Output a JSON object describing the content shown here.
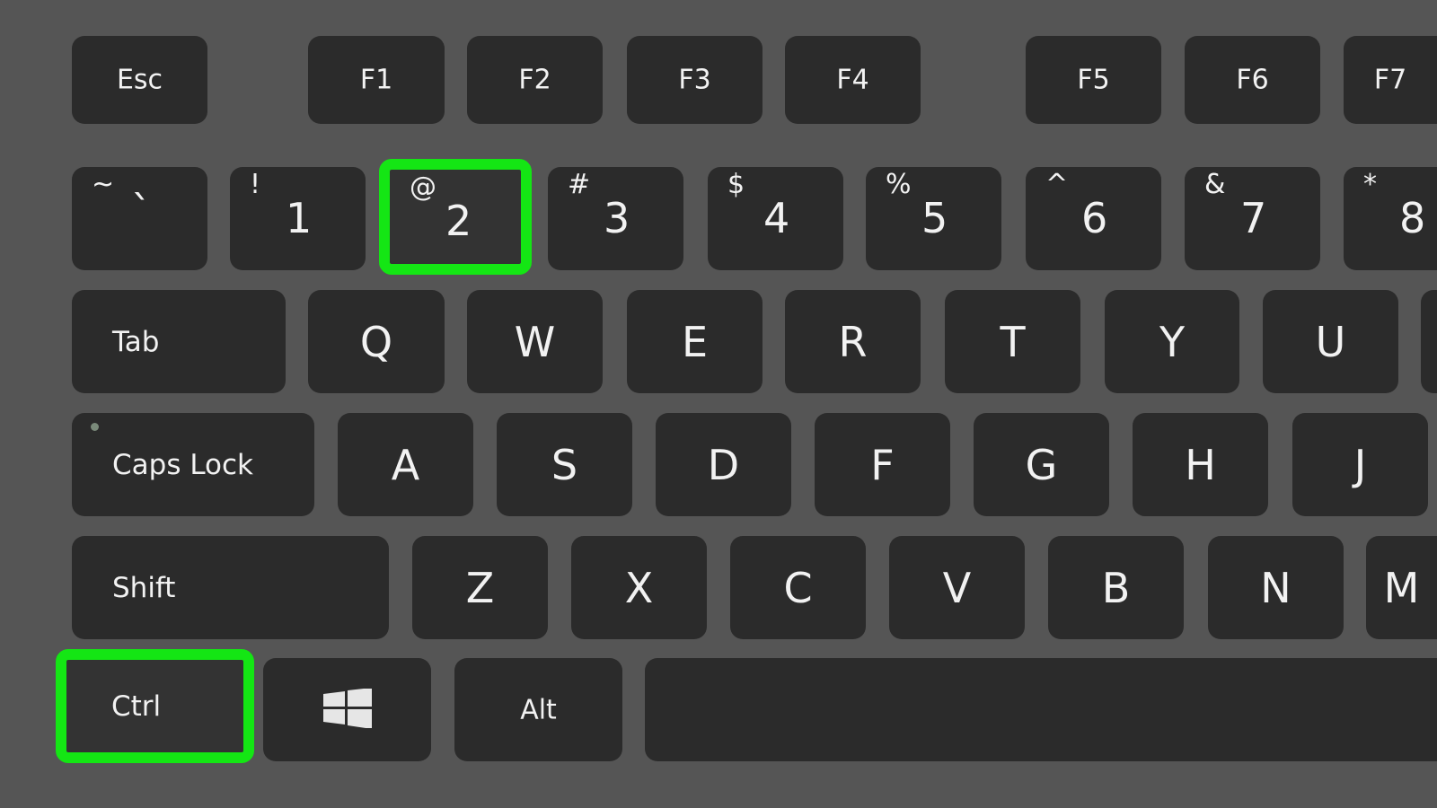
{
  "colors": {
    "background": "#555555",
    "key": "#2b2b2b",
    "highlight": "#14e614",
    "text": "#f2f2f2"
  },
  "highlighted_keys": [
    "Ctrl",
    "2"
  ],
  "keys": {
    "esc": "Esc",
    "f1": "F1",
    "f2": "F2",
    "f3": "F3",
    "f4": "F4",
    "f5": "F5",
    "f6": "F6",
    "f7": "F7",
    "grave": {
      "main": "`",
      "sym": "~"
    },
    "d1": {
      "main": "1",
      "sym": "!"
    },
    "d2": {
      "main": "2",
      "sym": "@"
    },
    "d3": {
      "main": "3",
      "sym": "#"
    },
    "d4": {
      "main": "4",
      "sym": "$"
    },
    "d5": {
      "main": "5",
      "sym": "%"
    },
    "d6": {
      "main": "6",
      "sym": "^"
    },
    "d7": {
      "main": "7",
      "sym": "&"
    },
    "d8": {
      "main": "8",
      "sym": "*"
    },
    "tab": "Tab",
    "q": "Q",
    "w": "W",
    "e": "E",
    "r": "R",
    "t": "T",
    "y": "Y",
    "u": "U",
    "i": "",
    "caps": "Caps Lock",
    "a": "A",
    "s": "S",
    "d": "D",
    "f": "F",
    "g": "G",
    "h": "H",
    "j": "J",
    "shift": "Shift",
    "z": "Z",
    "x": "X",
    "c": "C",
    "v": "V",
    "b": "B",
    "n": "N",
    "m": "M",
    "ctrl": "Ctrl",
    "win": "windows-logo-icon",
    "alt": "Alt",
    "space": ""
  }
}
